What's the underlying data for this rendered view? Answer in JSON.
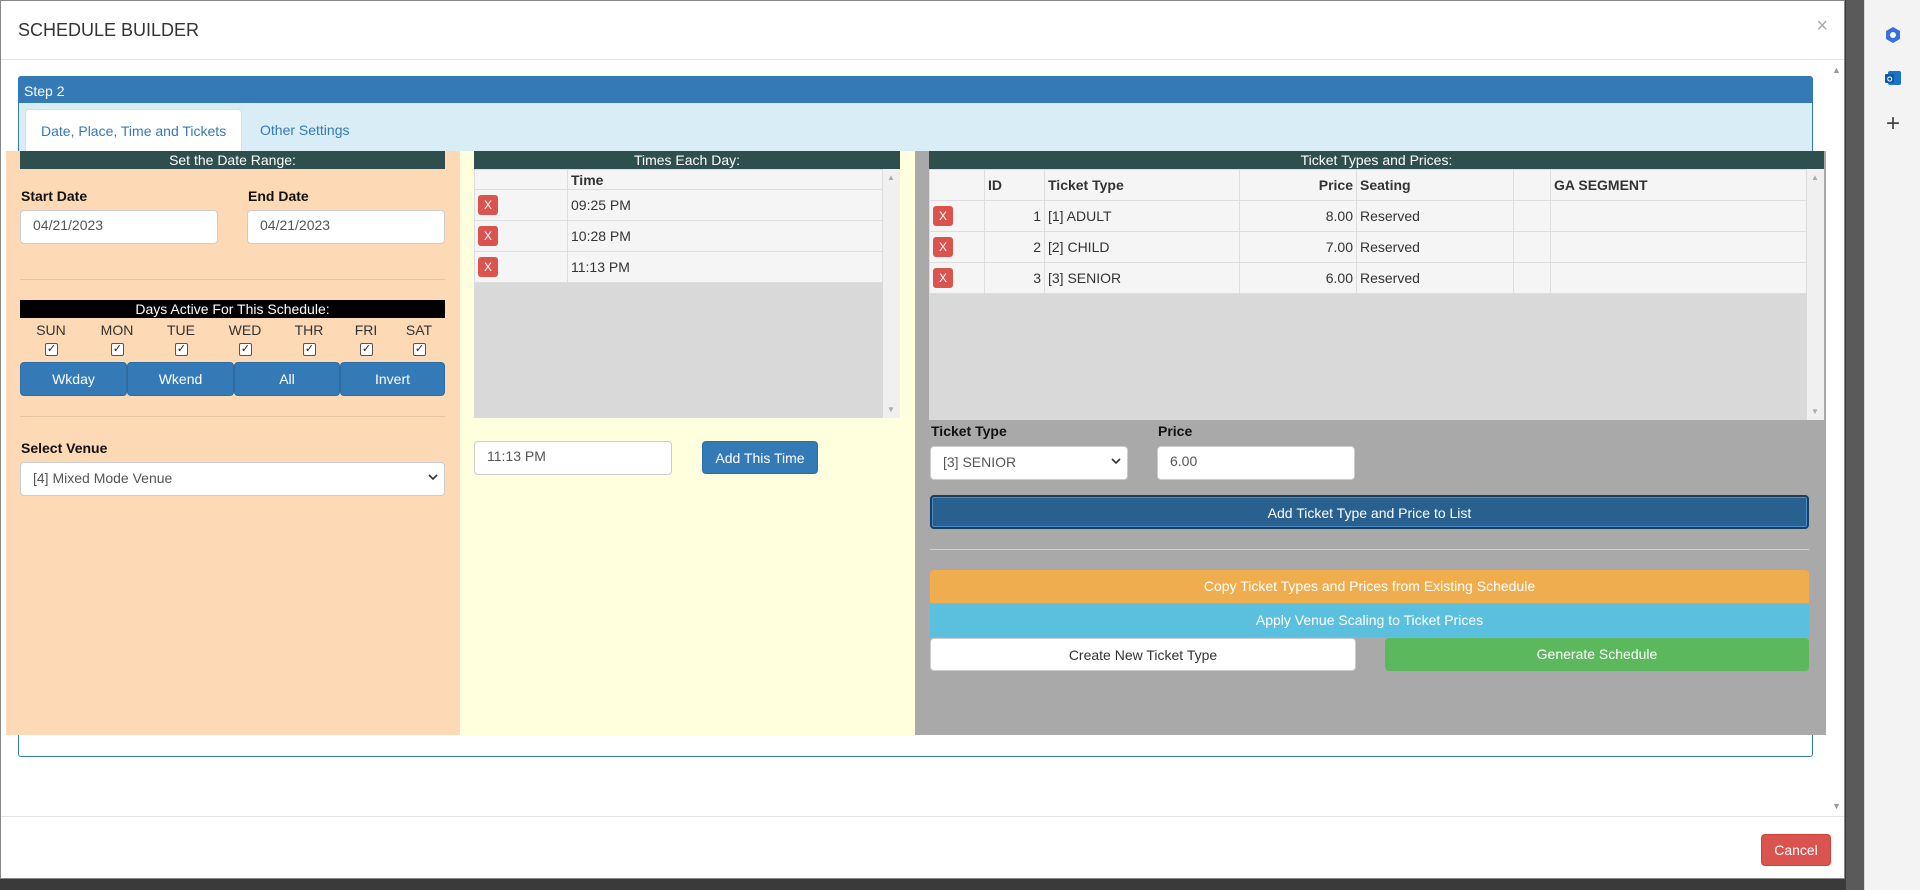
{
  "modal": {
    "title": "SCHEDULE BUILDER",
    "close_glyph": "×",
    "cancel_label": "Cancel"
  },
  "panel": {
    "heading": "Step 2",
    "tabs": [
      {
        "label": "Date, Place, Time and Tickets",
        "active": true
      },
      {
        "label": "Other Settings",
        "active": false
      }
    ]
  },
  "date_range": {
    "header": "Set the Date Range:",
    "start_label": "Start Date",
    "start_value": "04/21/2023",
    "end_label": "End Date",
    "end_value": "04/21/2023"
  },
  "days": {
    "header": "Days Active For This Schedule:",
    "names": [
      "SUN",
      "MON",
      "TUE",
      "WED",
      "THR",
      "FRI",
      "SAT"
    ],
    "checked": [
      true,
      true,
      true,
      true,
      true,
      true,
      true
    ],
    "check_glyph": "✓",
    "buttons": [
      "Wkday",
      "Wkend",
      "All",
      "Invert"
    ]
  },
  "venue": {
    "label": "Select Venue",
    "selected": "[4] Mixed Mode Venue",
    "chevron": "⌄"
  },
  "times": {
    "header": "Times Each Day:",
    "column": "Time",
    "rows": [
      "09:25 PM",
      "10:28 PM",
      "11:13 PM"
    ],
    "remove_glyph": "X",
    "input_value": "11:13 PM",
    "add_label": "Add This Time"
  },
  "tickets": {
    "header": "Ticket Types and Prices:",
    "columns": [
      "ID",
      "Ticket Type",
      "Price",
      "Seating",
      "",
      "GA SEGMENT"
    ],
    "rows": [
      {
        "id": "1",
        "type": "[1] ADULT",
        "price": "8.00",
        "seating": "Reserved"
      },
      {
        "id": "2",
        "type": "[2] CHILD",
        "price": "7.00",
        "seating": "Reserved"
      },
      {
        "id": "3",
        "type": "[3] SENIOR",
        "price": "6.00",
        "seating": "Reserved"
      }
    ],
    "type_label": "Ticket Type",
    "type_selected": "[3] SENIOR",
    "price_label": "Price",
    "price_value": "6.00",
    "add_label": "Add Ticket Type and Price to List",
    "copy_label": "Copy Ticket Types and Prices from Existing Schedule",
    "scaling_label": "Apply Venue Scaling to Ticket Prices",
    "create_label": "Create New Ticket Type",
    "generate_label": "Generate Schedule"
  },
  "colors": {
    "primary": "#337ab7",
    "danger": "#d9534f",
    "warning": "#f0ad4e",
    "info": "#5bc0de",
    "success": "#5cb85c",
    "dark_header": "#2f4f4f",
    "left_bg": "#fdd9b5",
    "mid_bg": "#ffffdd",
    "right_bg": "#a9a9a9"
  },
  "side_rail": {
    "icons": [
      "hexagon-icon",
      "outlook-icon",
      "plus-icon"
    ],
    "plus_glyph": "+"
  }
}
